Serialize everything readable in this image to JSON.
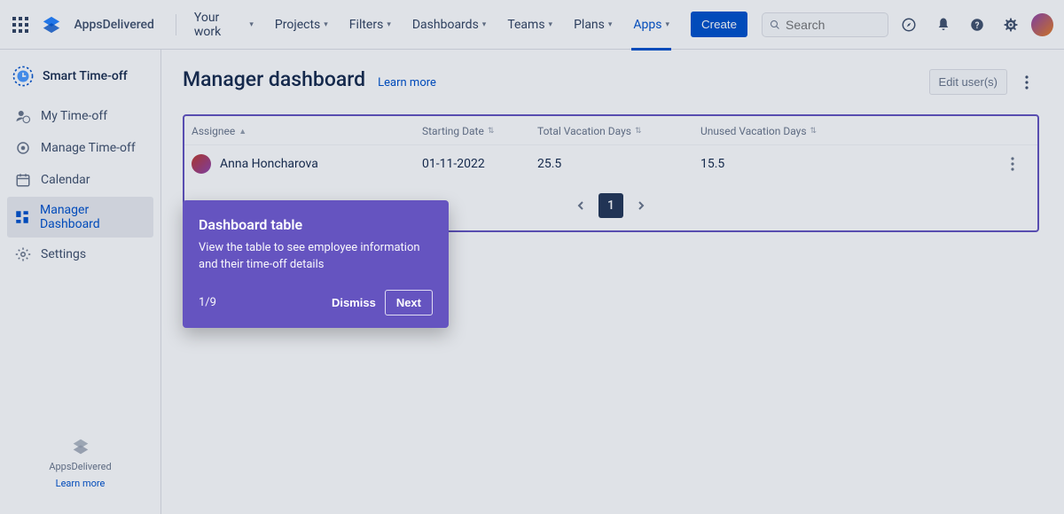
{
  "topnav": {
    "brand": "AppsDelivered",
    "items": [
      {
        "label": "Your work",
        "key": "your-work"
      },
      {
        "label": "Projects",
        "key": "projects"
      },
      {
        "label": "Filters",
        "key": "filters"
      },
      {
        "label": "Dashboards",
        "key": "dashboards"
      },
      {
        "label": "Teams",
        "key": "teams"
      },
      {
        "label": "Plans",
        "key": "plans"
      },
      {
        "label": "Apps",
        "key": "apps",
        "active": true
      }
    ],
    "create": "Create",
    "search_placeholder": "Search"
  },
  "sidebar": {
    "app_name": "Smart Time-off",
    "items": [
      {
        "label": "My Time-off",
        "key": "my-time-off"
      },
      {
        "label": "Manage Time-off",
        "key": "manage-time-off"
      },
      {
        "label": "Calendar",
        "key": "calendar"
      },
      {
        "label": "Manager Dashboard",
        "key": "manager-dashboard",
        "active": true
      },
      {
        "label": "Settings",
        "key": "settings"
      }
    ],
    "footer_brand": "AppsDelivered",
    "footer_link": "Learn more"
  },
  "page": {
    "title": "Manager dashboard",
    "learn_more": "Learn more",
    "edit_users": "Edit user(s)"
  },
  "table": {
    "headers": {
      "assignee": "Assignee",
      "starting": "Starting Date",
      "total": "Total Vacation Days",
      "unused": "Unused Vacation Days"
    },
    "rows": [
      {
        "assignee": "Anna Honcharova",
        "starting": "01-11-2022",
        "total": "25.5",
        "unused": "15.5"
      }
    ],
    "page_current": "1"
  },
  "tour": {
    "title": "Dashboard table",
    "body": "View the table to see employee information and their time-off details",
    "step": "1/9",
    "dismiss": "Dismiss",
    "next": "Next"
  }
}
